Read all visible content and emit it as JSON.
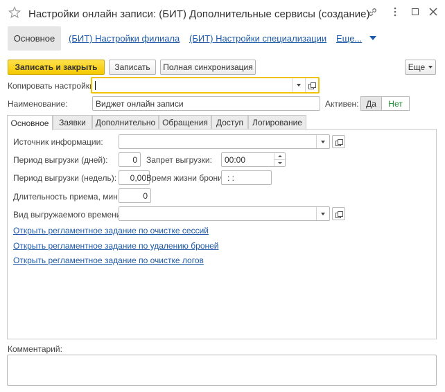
{
  "window": {
    "title": "Настройки онлайн записи: (БИТ) Дополнительные сервисы (создание)"
  },
  "nav": {
    "main": "Основное",
    "links": [
      "(БИТ) Настройки филиала",
      "(БИТ) Настройки специализации"
    ],
    "more": "Еще..."
  },
  "toolbar": {
    "save_close": "Записать и закрыть",
    "save": "Записать",
    "sync": "Полная синхронизация",
    "more": "Еще"
  },
  "form": {
    "copy_label": "Копировать настройки:",
    "copy_value": "",
    "name_label": "Наименование:",
    "name_value": "Виджет онлайн записи",
    "active_label": "Активен:",
    "yes": "Да",
    "no": "Нет"
  },
  "tabs": [
    "Основное",
    "Заявки",
    "Дополнительно",
    "Обращения",
    "Доступ",
    "Логирование"
  ],
  "main": {
    "source_label": "Источник информации:",
    "source_value": "",
    "period_days_label": "Период выгрузки (дней):",
    "period_days_value": "0",
    "ban_label": "Запрет выгрузки:",
    "ban_value": "00:00",
    "period_weeks_label": "Период выгрузки (недель):",
    "period_weeks_value": "0,00",
    "ttl_label": "Время жизни брони:",
    "ttl_value": ": :",
    "duration_label": "Длительность приема, мин.:",
    "duration_value": "0",
    "time_kind_label": "Вид выгружаемого времени:",
    "time_kind_value": "",
    "links": [
      "Открыть регламентное задание по очистке сессий",
      "Открыть регламентное задание по удалению броней",
      "Открыть регламентное задание по очистке логов"
    ]
  },
  "comment": {
    "label": "Комментарий:",
    "value": ""
  },
  "colors": {
    "accent_yellow": "#f5c800",
    "link_blue": "#1e5aa8",
    "active_green": "#1a8a2e"
  }
}
